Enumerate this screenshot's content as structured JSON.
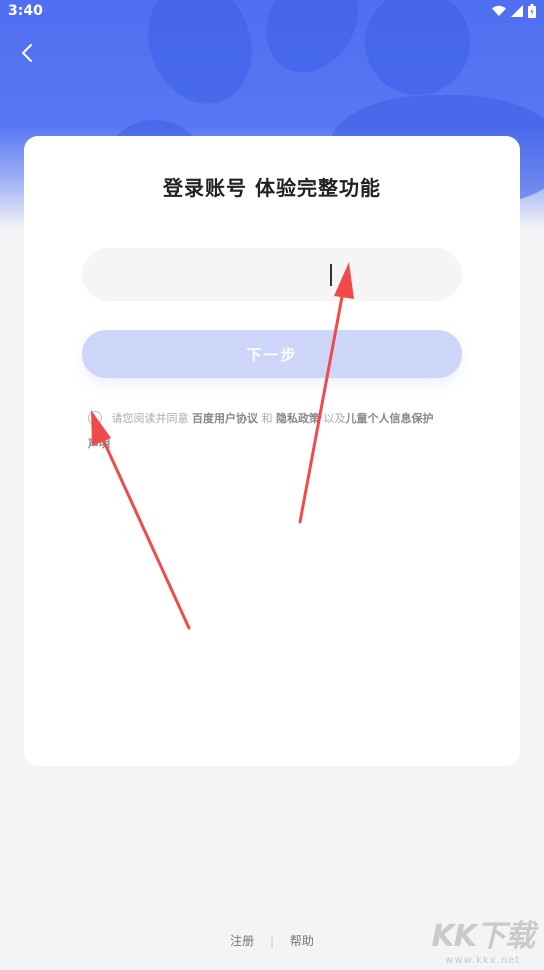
{
  "status_bar": {
    "time": "3:40",
    "icons": [
      "wifi-icon",
      "cellular-signal-icon",
      "battery-icon"
    ]
  },
  "nav": {
    "back_icon": "chevron-left-icon"
  },
  "login": {
    "title": "登录账号 体验完整功能",
    "input_value": "",
    "next_label": "下一步"
  },
  "agreement": {
    "prefix": "请您阅读并同意",
    "terms_link": "百度用户协议",
    "and": "和",
    "privacy_link": "隐私政策",
    "also": "以及",
    "child_link_1": "儿童个人信息保护",
    "child_link_2": "声明"
  },
  "footer": {
    "register": "注册",
    "separator": "|",
    "help": "帮助"
  },
  "watermark": {
    "logo": "KK下载",
    "url": "www.kkx.net"
  },
  "colors": {
    "primary": "#5877f3",
    "button_disabled": "#cdd6f9",
    "arrow": "#f04b4b"
  }
}
